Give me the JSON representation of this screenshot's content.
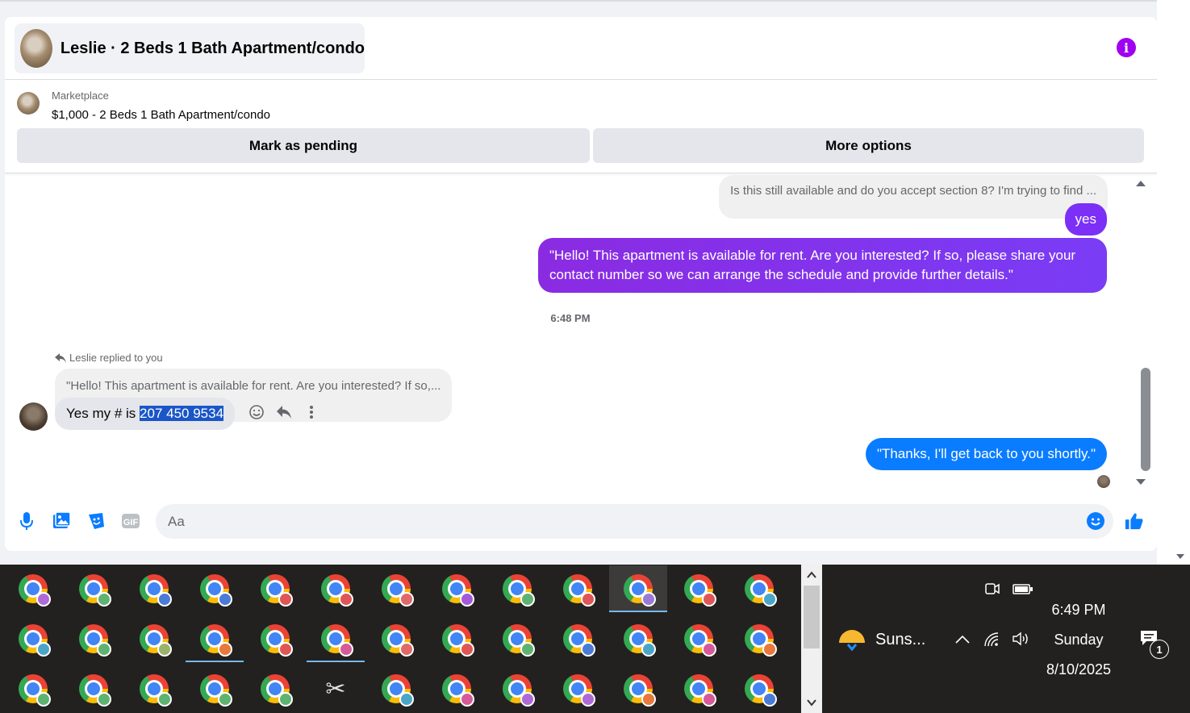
{
  "header": {
    "title": "Leslie · 2 Beds 1 Bath Apartment/condo"
  },
  "listing": {
    "source": "Marketplace",
    "title": "$1,000 - 2 Beds 1 Bath Apartment/condo",
    "mark_pending_label": "Mark as pending",
    "more_options_label": "More options"
  },
  "messages": {
    "incoming_quote": "Is this still available and do you accept section 8? I'm trying to find ...",
    "outgoing_yes": "yes",
    "outgoing_long": "\"Hello! This apartment is available for rent. Are you interested? If so, please share your contact number so we can arrange the schedule and provide further details.\"",
    "timestamp": "6:48 PM",
    "replied_label": "Leslie replied to you",
    "reply_quote": "\"Hello! This apartment is available for rent. Are you interested? If so,...",
    "incoming_prefix": "Yes my # is ",
    "incoming_number": "207 450 9534",
    "outgoing_blue": "\"Thanks, I'll get back to you shortly.\""
  },
  "composer": {
    "placeholder": "Aa"
  },
  "taskbar": {
    "badge_colors": [
      [
        "#b06ad8",
        "#5fb371",
        "#4a7bd6",
        "#4a7bd6",
        "#e05656",
        "#e05656",
        "#e06a6a",
        "#a45ad8",
        "#5fb371",
        "#e05656",
        "#9a7ad8",
        "#e05656",
        "#4aa6c8"
      ],
      [
        "#4aa6c8",
        "#5fb371",
        "#9ab36a",
        "#e8783c",
        "#e05656",
        "#d65a9a",
        "#e06a6a",
        "#e05656",
        "#5fb371",
        "#4a7bd6",
        "#4aa6c8",
        "#d65a9a",
        "#e8783c"
      ],
      [
        "#5fb371",
        "#5fb371",
        "#5fb371",
        "#5fb371",
        "#5fb371",
        "snip",
        "#4aa6c8",
        "#d65a9a",
        "#b06ad8",
        "#b06ad8",
        "#e8783c",
        "#d65a9a",
        "#4a7bd6"
      ]
    ],
    "active_cell": "r0c10",
    "underlined_cells": [
      "r0c10",
      "r1c3",
      "r1c5"
    ]
  },
  "tray": {
    "weather": "Suns...",
    "time": "6:49 PM",
    "day": "Sunday",
    "date": "8/10/2025",
    "notification_count": "1"
  }
}
